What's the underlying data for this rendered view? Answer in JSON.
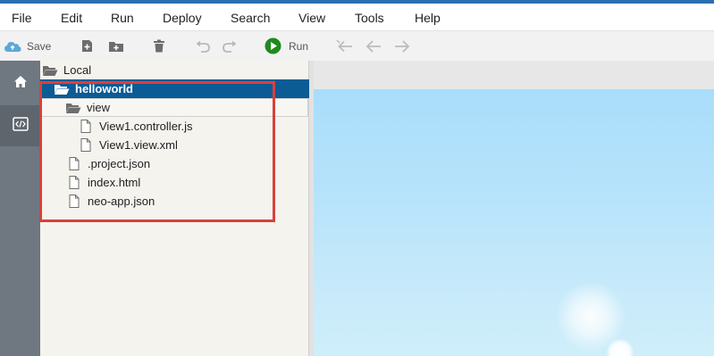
{
  "menubar": {
    "items": [
      "File",
      "Edit",
      "Run",
      "Deploy",
      "Search",
      "View",
      "Tools",
      "Help"
    ]
  },
  "toolbar": {
    "save_label": "Save",
    "run_label": "Run",
    "icons": [
      "cloud-save-icon",
      "new-file-icon",
      "new-folder-icon",
      "delete-icon",
      "undo-icon",
      "redo-icon",
      "run-icon",
      "back-to-edit-icon",
      "back-icon",
      "forward-icon"
    ]
  },
  "leftbar": {
    "icons": [
      "home-icon",
      "code-editor-icon"
    ]
  },
  "tree": {
    "root": "Local",
    "project": "helloworld",
    "folder": "view",
    "files_in_view": [
      "View1.controller.js",
      "View1.view.xml"
    ],
    "files": [
      ".project.json",
      "index.html",
      "neo-app.json"
    ]
  },
  "colors": {
    "accent": "#0b5b95",
    "highlight": "#d9403a",
    "run_green": "#1e8a1e"
  }
}
